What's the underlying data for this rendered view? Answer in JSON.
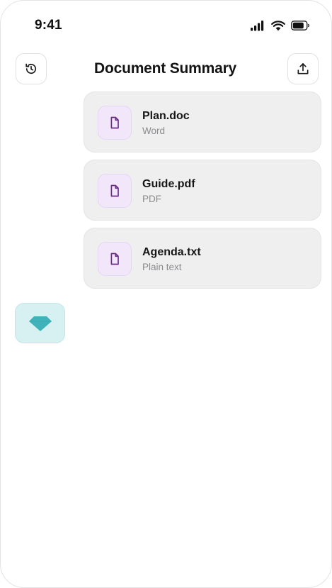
{
  "status_bar": {
    "time": "9:41"
  },
  "header": {
    "title": "Document Summary",
    "left_icon": "history-icon",
    "right_icon": "upload-icon"
  },
  "files": [
    {
      "name": "Plan.doc",
      "type": "Word",
      "icon": "document-icon"
    },
    {
      "name": "Guide.pdf",
      "type": "PDF",
      "icon": "document-icon"
    },
    {
      "name": "Agenda.txt",
      "type": "Plain text",
      "icon": "document-icon"
    }
  ],
  "assistant_badge": {
    "icon": "gem-icon"
  },
  "colors": {
    "card_background": "#efefef",
    "file_icon_bg": "#f2e6fb",
    "file_icon_stroke": "#6b2c84",
    "gem_badge_bg": "#d7f0f1",
    "gem_color": "#3fb3b9"
  }
}
